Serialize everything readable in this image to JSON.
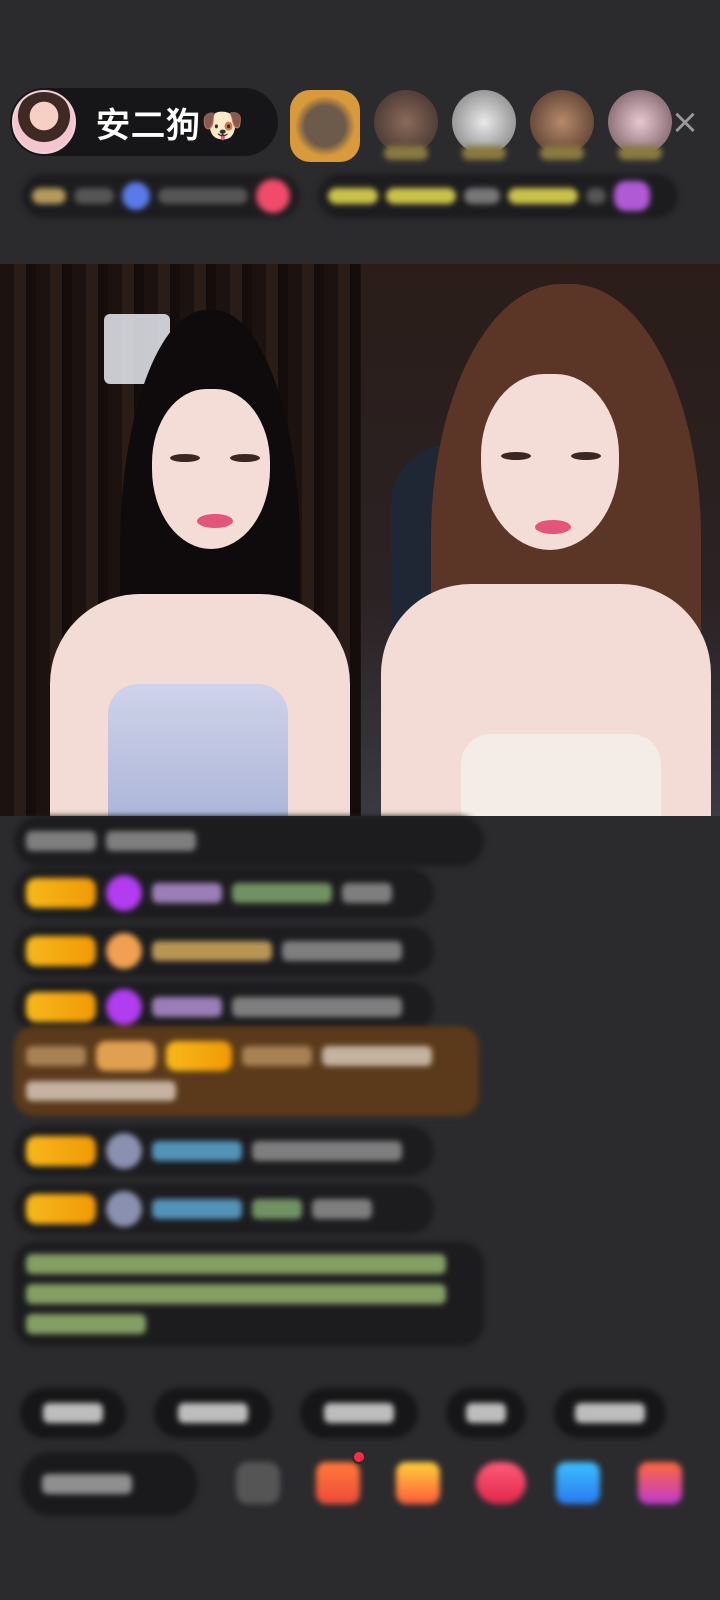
{
  "header": {
    "host_name": "安二狗🐶",
    "close_icon_glyph": "×"
  },
  "colors": {
    "background": "#2b2b2e",
    "level_badge": "#f7b81b",
    "highlight_message": "#5a3a1a"
  },
  "icons": {
    "host_avatar": "avatar",
    "viewers": [
      "viewer-avatar",
      "viewer-avatar",
      "viewer-avatar",
      "viewer-avatar",
      "viewer-avatar"
    ],
    "close": "close-icon",
    "gift_tools": [
      "emoji-icon",
      "gift-box-icon",
      "treasure-icon",
      "heart-gift-icon",
      "game-icon",
      "more-gift-icon"
    ]
  }
}
